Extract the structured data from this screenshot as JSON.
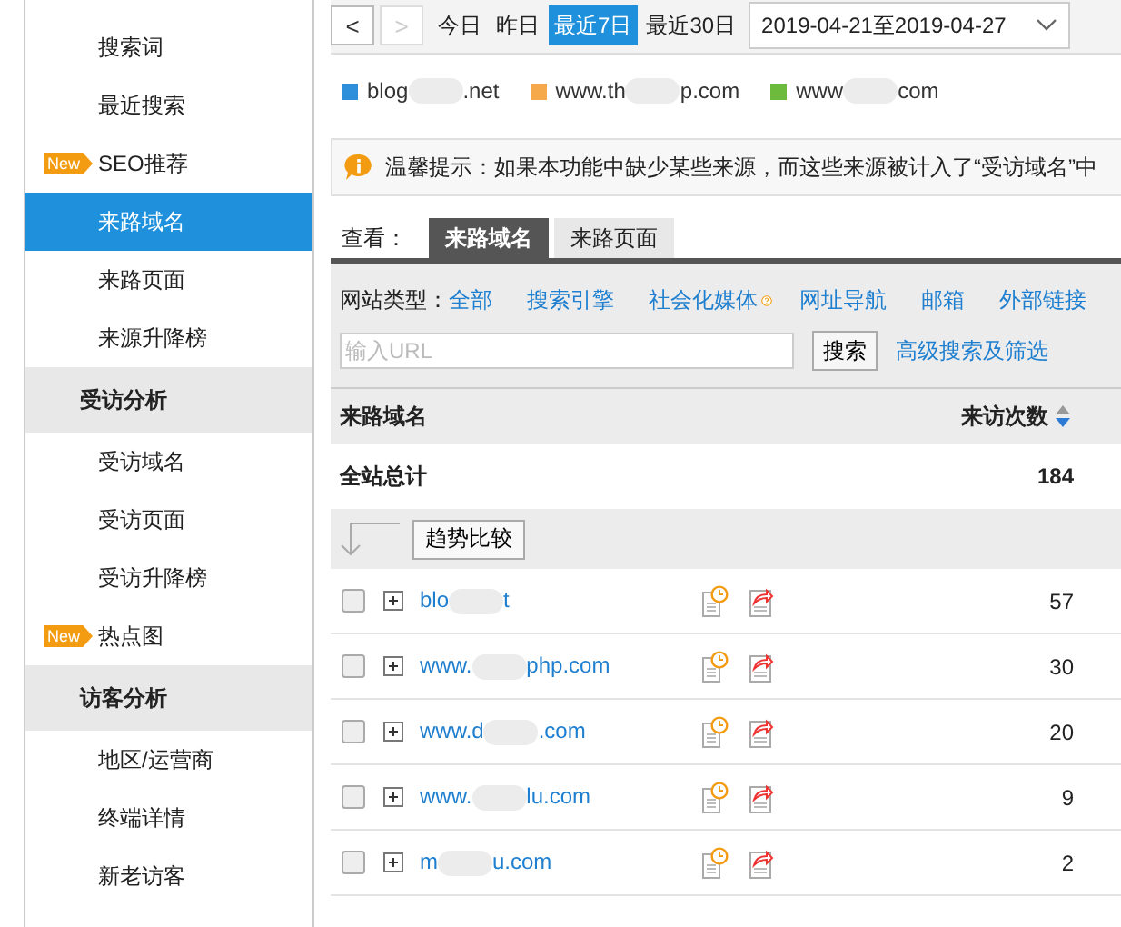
{
  "sidebar": {
    "items": [
      {
        "label": "搜索词",
        "kind": "item",
        "selected": false
      },
      {
        "label": "最近搜索",
        "kind": "item",
        "selected": false
      },
      {
        "label": "SEO推荐",
        "kind": "item",
        "selected": false,
        "badge": "New"
      },
      {
        "label": "来路域名",
        "kind": "item",
        "selected": true
      },
      {
        "label": "来路页面",
        "kind": "item",
        "selected": false
      },
      {
        "label": "来源升降榜",
        "kind": "item",
        "selected": false
      },
      {
        "label": "受访分析",
        "kind": "group"
      },
      {
        "label": "受访域名",
        "kind": "item",
        "selected": false
      },
      {
        "label": "受访页面",
        "kind": "item",
        "selected": false
      },
      {
        "label": "受访升降榜",
        "kind": "item",
        "selected": false
      },
      {
        "label": "热点图",
        "kind": "item",
        "selected": false,
        "badge": "New"
      },
      {
        "label": "访客分析",
        "kind": "group"
      },
      {
        "label": "地区/运营商",
        "kind": "item",
        "selected": false
      },
      {
        "label": "终端详情",
        "kind": "item",
        "selected": false
      },
      {
        "label": "新老访客",
        "kind": "item",
        "selected": false
      }
    ]
  },
  "date_bar": {
    "prev": "<",
    "next": ">",
    "ranges": [
      {
        "label": "今日",
        "selected": false
      },
      {
        "label": "昨日",
        "selected": false
      },
      {
        "label": "最近7日",
        "selected": true
      },
      {
        "label": "最近30日",
        "selected": false
      }
    ],
    "date_range": "2019-04-21至2019-04-27"
  },
  "legend": [
    {
      "prefix": "blog",
      "suffix": ".net",
      "color": "#2e8fdb"
    },
    {
      "prefix": "www.th",
      "suffix": "p.com",
      "color": "#f5a94a"
    },
    {
      "prefix": "www",
      "suffix": "com",
      "color": "#6cbb3c"
    }
  ],
  "notice": "温馨提示：如果本功能中缺少某些来源，而这些来源被计入了“受访域名”中",
  "view": {
    "label": "查看：",
    "tabs": [
      {
        "label": "来路域名",
        "selected": true
      },
      {
        "label": "来路页面",
        "selected": false
      }
    ]
  },
  "filters": {
    "label": "网站类型：",
    "types": [
      {
        "label": "全部",
        "help": false
      },
      {
        "label": "搜索引擎",
        "help": false
      },
      {
        "label": "社会化媒体",
        "help": true
      },
      {
        "label": "网址导航",
        "help": false
      },
      {
        "label": "邮箱",
        "help": false
      },
      {
        "label": "外部链接",
        "help": false
      }
    ],
    "search": {
      "placeholder": "输入URL",
      "button": "搜索"
    },
    "advanced": "高级搜索及筛选"
  },
  "table": {
    "columns": [
      "来路域名",
      "来访次数"
    ],
    "total": {
      "label": "全站总计",
      "value": "184"
    },
    "trend_button": "趋势比较",
    "rows": [
      {
        "prefix": "blo",
        "suffix": "t",
        "visits": "57",
        "checked": false
      },
      {
        "prefix": "www.",
        "suffix": "php.com",
        "visits": "30",
        "checked": false
      },
      {
        "prefix": "www.d",
        "suffix": ".com",
        "visits": "20",
        "checked": false
      },
      {
        "prefix": "www.",
        "suffix": "lu.com",
        "visits": "9",
        "checked": false
      },
      {
        "prefix": "m",
        "suffix": "u.com",
        "visits": "2",
        "checked": false
      }
    ]
  }
}
